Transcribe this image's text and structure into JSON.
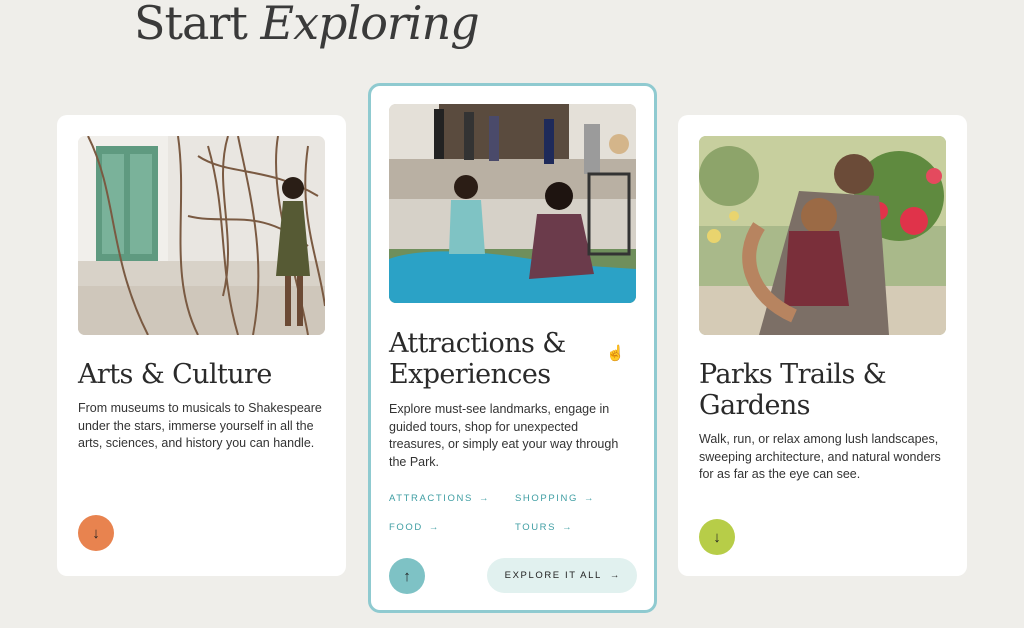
{
  "heading": {
    "plain": "Start ",
    "italic": "Exploring"
  },
  "cards": [
    {
      "title": "Arts & Culture",
      "description": "From museums to musicals to Shakespeare under the stars, immerse yourself in all the arts, sciences, and history you can handle.",
      "button_icon": "↓",
      "accent": "#e8834f"
    },
    {
      "title": "Attractions & Experiences",
      "description": "Explore must-see landmarks, engage in guided tours, shop for unexpected treasures, or simply eat your way through the Park.",
      "links": [
        {
          "label": "ATTRACTIONS",
          "arrow": "→"
        },
        {
          "label": "SHOPPING",
          "arrow": "→"
        },
        {
          "label": "FOOD",
          "arrow": "→"
        },
        {
          "label": "TOURS",
          "arrow": "→"
        }
      ],
      "button_icon": "↑",
      "accent": "#7ec2c5",
      "cta": {
        "label": "EXPLORE IT ALL",
        "arrow": "→"
      }
    },
    {
      "title": "Parks Trails & Gardens",
      "description": "Walk, run, or relax among lush landscapes, sweeping architecture, and natural wonders for as far as the eye can see.",
      "button_icon": "↓",
      "accent": "#b7cd48"
    }
  ],
  "cursor_icon": "hand-pointer-icon"
}
